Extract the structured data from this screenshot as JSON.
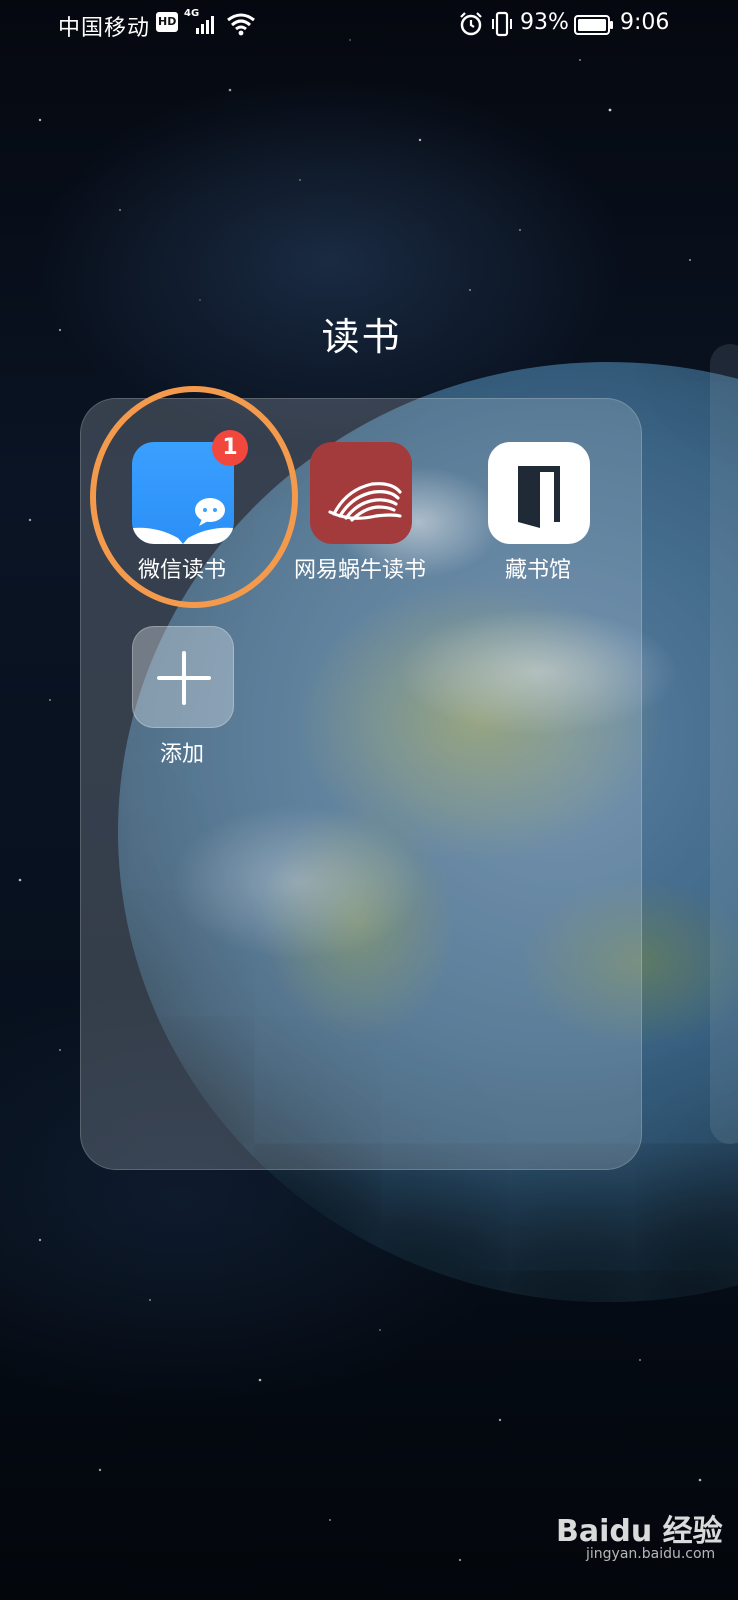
{
  "status_bar": {
    "carrier": "中国移动",
    "hd": "HD",
    "network": "4G",
    "battery_percent": "93%",
    "time": "9:06",
    "icons": [
      "hd-icon",
      "signal-icon",
      "wifi-icon",
      "alarm-icon",
      "vibrate-icon",
      "battery-icon"
    ]
  },
  "folder": {
    "title": "读书",
    "apps": [
      {
        "label": "微信读书",
        "icon": "weread-icon",
        "badge": "1",
        "highlighted": true
      },
      {
        "label": "网易蜗牛读书",
        "icon": "netease-snail-reading-icon"
      },
      {
        "label": "藏书馆",
        "icon": "library-door-icon"
      }
    ],
    "add": {
      "label": "添加",
      "icon": "plus-icon"
    }
  },
  "watermark": {
    "brand": "Baidu 经验",
    "url": "jingyan.baidu.com"
  },
  "colors": {
    "highlight_ring": "#f39a4c",
    "badge": "#f2473d",
    "weread_blue": "#2b8ff6",
    "netease_red": "#a33a3c"
  }
}
